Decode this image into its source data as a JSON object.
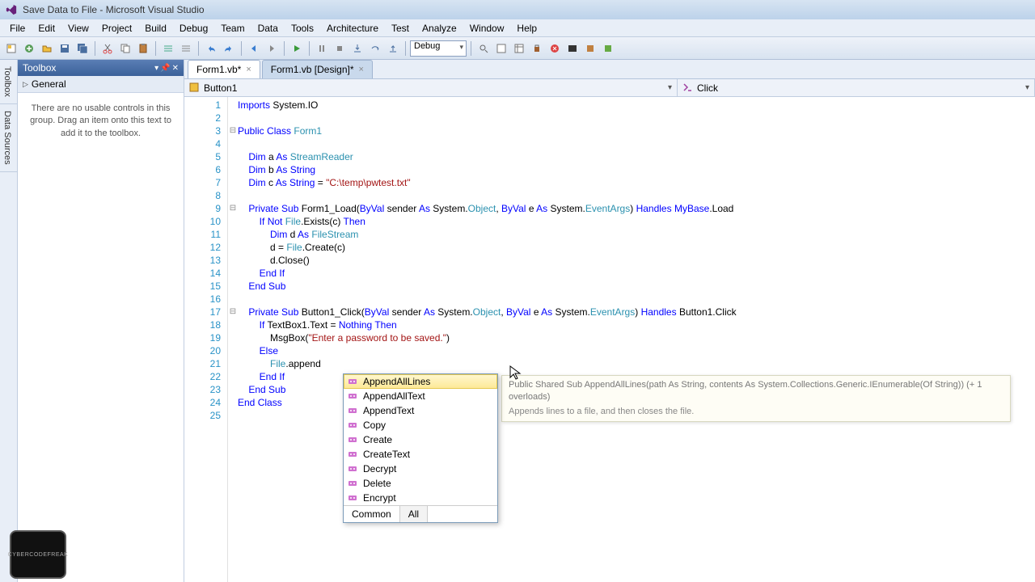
{
  "window": {
    "title": "Save Data to File - Microsoft Visual Studio"
  },
  "menubar": [
    "File",
    "Edit",
    "View",
    "Project",
    "Build",
    "Debug",
    "Team",
    "Data",
    "Tools",
    "Architecture",
    "Test",
    "Analyze",
    "Window",
    "Help"
  ],
  "toolbar": {
    "config": "Debug"
  },
  "side_tabs": [
    "Toolbox",
    "Data Sources"
  ],
  "toolbox": {
    "title": "Toolbox",
    "section": "General",
    "empty_text": "There are no usable controls in this group. Drag an item onto this text to add it to the toolbox."
  },
  "doc_tabs": [
    {
      "label": "Form1.vb*",
      "active": true
    },
    {
      "label": "Form1.vb [Design]*",
      "active": false
    }
  ],
  "nav": {
    "left": "Button1",
    "right": "Click"
  },
  "code": {
    "lines": [
      {
        "n": 1,
        "html": "<span class='kw'>Imports</span> System.IO"
      },
      {
        "n": 2,
        "html": ""
      },
      {
        "n": 3,
        "html": "<span class='kw'>Public</span> <span class='kw'>Class</span> <span class='typ'>Form1</span>",
        "fold": "-"
      },
      {
        "n": 4,
        "html": ""
      },
      {
        "n": 5,
        "html": "    <span class='kw'>Dim</span> a <span class='kw'>As</span> <span class='typ'>StreamReader</span>"
      },
      {
        "n": 6,
        "html": "    <span class='kw'>Dim</span> b <span class='kw'>As</span> <span class='kw'>String</span>"
      },
      {
        "n": 7,
        "html": "    <span class='kw'>Dim</span> c <span class='kw'>As</span> <span class='kw'>String</span> = <span class='str'>\"C:\\temp\\pwtest.txt\"</span>"
      },
      {
        "n": 8,
        "html": ""
      },
      {
        "n": 9,
        "html": "    <span class='kw'>Private</span> <span class='kw'>Sub</span> Form1_Load(<span class='kw'>ByVal</span> sender <span class='kw'>As</span> System.<span class='typ'>Object</span>, <span class='kw'>ByVal</span> e <span class='kw'>As</span> System.<span class='typ'>EventArgs</span>) <span class='kw'>Handles</span> <span class='kw'>MyBase</span>.Load",
        "fold": "-"
      },
      {
        "n": 10,
        "html": "        <span class='kw'>If</span> <span class='kw'>Not</span> <span class='typ'>File</span>.Exists(c) <span class='kw'>Then</span>"
      },
      {
        "n": 11,
        "html": "            <span class='kw'>Dim</span> d <span class='kw'>As</span> <span class='typ'>FileStream</span>"
      },
      {
        "n": 12,
        "html": "            d = <span class='typ'>File</span>.Create(c)"
      },
      {
        "n": 13,
        "html": "            d.Close()"
      },
      {
        "n": 14,
        "html": "        <span class='kw'>End</span> <span class='kw'>If</span>"
      },
      {
        "n": 15,
        "html": "    <span class='kw'>End</span> <span class='kw'>Sub</span>"
      },
      {
        "n": 16,
        "html": ""
      },
      {
        "n": 17,
        "html": "    <span class='kw'>Private</span> <span class='kw'>Sub</span> Button1_Click(<span class='kw'>ByVal</span> sender <span class='kw'>As</span> System.<span class='typ'>Object</span>, <span class='kw'>ByVal</span> e <span class='kw'>As</span> System.<span class='typ'>EventArgs</span>) <span class='kw'>Handles</span> Button1.Click",
        "fold": "-"
      },
      {
        "n": 18,
        "html": "        <span class='kw'>If</span> TextBox1.Text = <span class='kw'>Nothing</span> <span class='kw'>Then</span>"
      },
      {
        "n": 19,
        "html": "            MsgBox(<span class='str'>\"Enter a password to be saved.\"</span>)"
      },
      {
        "n": 20,
        "html": "        <span class='kw'>Else</span>"
      },
      {
        "n": 21,
        "html": "            <span class='typ'>File</span>.append"
      },
      {
        "n": 22,
        "html": "        <span class='kw'>End</span> <span class='kw'>If</span>"
      },
      {
        "n": 23,
        "html": "    <span class='kw'>End</span> <span class='kw'>Sub</span>"
      },
      {
        "n": 24,
        "html": "<span class='kw'>End</span> <span class='kw'>Class</span>"
      },
      {
        "n": 25,
        "html": ""
      }
    ]
  },
  "intellisense": {
    "items": [
      {
        "label": "AppendAllLines",
        "kind": "method",
        "selected": true
      },
      {
        "label": "AppendAllText",
        "kind": "method"
      },
      {
        "label": "AppendText",
        "kind": "method"
      },
      {
        "label": "Copy",
        "kind": "method"
      },
      {
        "label": "Create",
        "kind": "method"
      },
      {
        "label": "CreateText",
        "kind": "method"
      },
      {
        "label": "Decrypt",
        "kind": "method"
      },
      {
        "label": "Delete",
        "kind": "method"
      },
      {
        "label": "Encrypt",
        "kind": "method"
      }
    ],
    "tabs": {
      "common": "Common",
      "all": "All",
      "active": "common"
    }
  },
  "tooltip": {
    "signature": "Public Shared Sub AppendAllLines(path As String, contents As System.Collections.Generic.IEnumerable(Of String)) (+ 1 overloads)",
    "description": "Appends lines to a file, and then closes the file."
  },
  "taskbar_thumb": "CYBERCODEFREAK"
}
